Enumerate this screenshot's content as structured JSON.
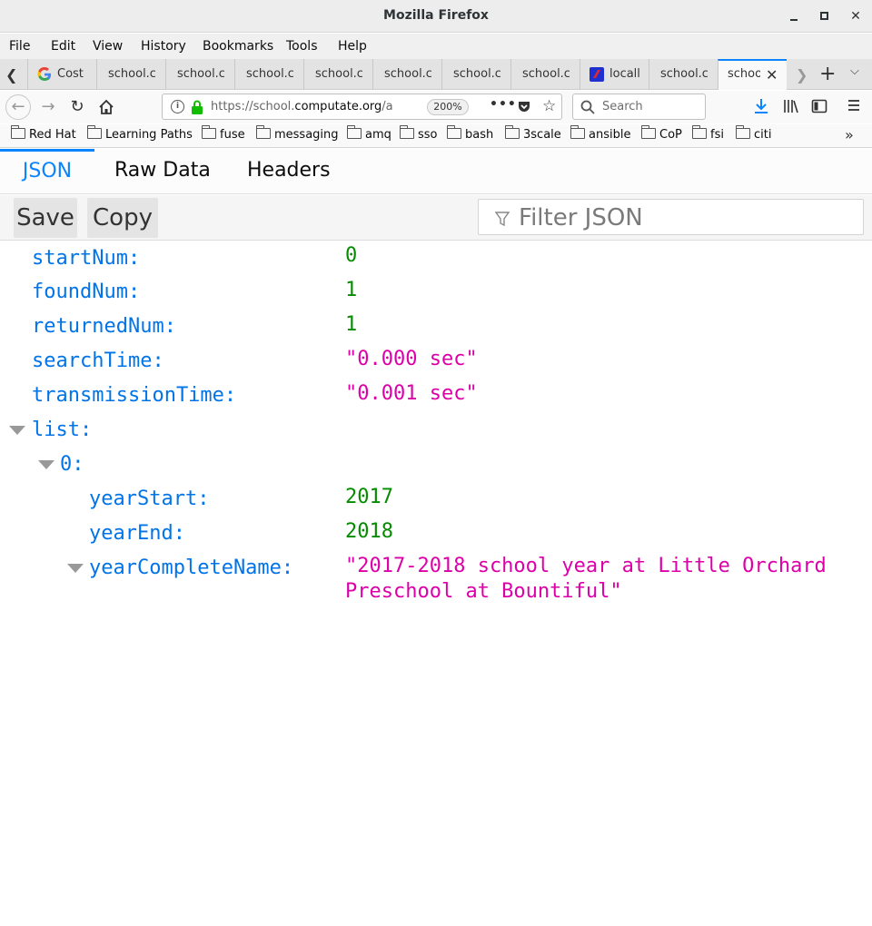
{
  "window": {
    "title": "Mozilla Firefox"
  },
  "menu": [
    "File",
    "Edit",
    "View",
    "History",
    "Bookmarks",
    "Tools",
    "Help"
  ],
  "tabs": [
    {
      "label": "Cost",
      "icon": "google-icon"
    },
    {
      "label": "school.co",
      "icon": ""
    },
    {
      "label": "school.co",
      "icon": ""
    },
    {
      "label": "school.co",
      "icon": ""
    },
    {
      "label": "school.co",
      "icon": ""
    },
    {
      "label": "school.co",
      "icon": ""
    },
    {
      "label": "school.co",
      "icon": ""
    },
    {
      "label": "school.co",
      "icon": ""
    },
    {
      "label": "locall",
      "icon": "app-icon"
    },
    {
      "label": "school.co",
      "icon": ""
    },
    {
      "label": "schoo",
      "icon": "",
      "active": true
    }
  ],
  "navbar": {
    "url_prefix": "https://school.",
    "url_domain": "computate.org",
    "url_suffix": "/a",
    "zoom": "200%",
    "search_placeholder": "Search"
  },
  "bookmarks": [
    "Red Hat",
    "Learning Paths",
    "fuse",
    "messaging",
    "amq",
    "sso",
    "bash",
    "3scale",
    "ansible",
    "CoP",
    "fsi",
    "citi"
  ],
  "viewer": {
    "tabs": [
      "JSON",
      "Raw Data",
      "Headers"
    ],
    "save_label": "Save",
    "copy_label": "Copy",
    "filter_placeholder": "Filter JSON"
  },
  "json": {
    "startNum_key": "startNum:",
    "startNum_val": "0",
    "foundNum_key": "foundNum:",
    "foundNum_val": "1",
    "returnedNum_key": "returnedNum:",
    "returnedNum_val": "1",
    "searchTime_key": "searchTime:",
    "searchTime_val": "\"0.000 sec\"",
    "transmissionTime_key": "transmissionTime:",
    "transmissionTime_val": "\"0.001 sec\"",
    "list_key": "list:",
    "item0_key": "0:",
    "yearStart_key": "yearStart:",
    "yearStart_val": "2017",
    "yearEnd_key": "yearEnd:",
    "yearEnd_val": "2018",
    "yearCompleteName_key": "yearCompleteName:",
    "yearCompleteName_val": "\"2017-2018 school year at Little Orchard Preschool at Bountiful\""
  },
  "colors": {
    "accent": "#0a84ff",
    "json_key": "#0074e8",
    "json_number": "#058b00",
    "json_string": "#dd00a9"
  }
}
